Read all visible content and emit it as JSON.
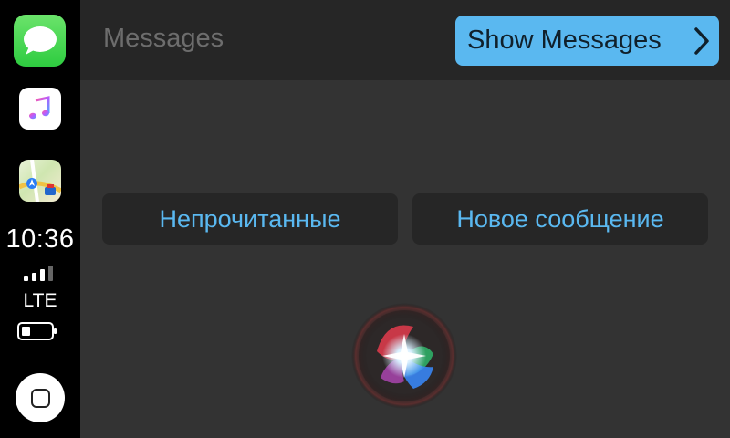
{
  "sidebar": {
    "apps": [
      {
        "name": "Messages",
        "icon": "messages-icon",
        "color": "#34c759"
      },
      {
        "name": "Music",
        "icon": "music-icon"
      },
      {
        "name": "Maps",
        "icon": "maps-icon"
      }
    ],
    "status": {
      "time": "10:36",
      "network": "LTE",
      "signal_bars": 4,
      "signal_bars_filled": 3
    }
  },
  "header": {
    "title": "Messages",
    "show_button_label": "Show Messages"
  },
  "options": [
    {
      "label": "Непрочитанные"
    },
    {
      "label": "Новое сообщение"
    }
  ],
  "colors": {
    "accent": "#5ab8f0",
    "background": "#333333",
    "header_bg": "#262626",
    "sidebar_bg": "#000000"
  }
}
